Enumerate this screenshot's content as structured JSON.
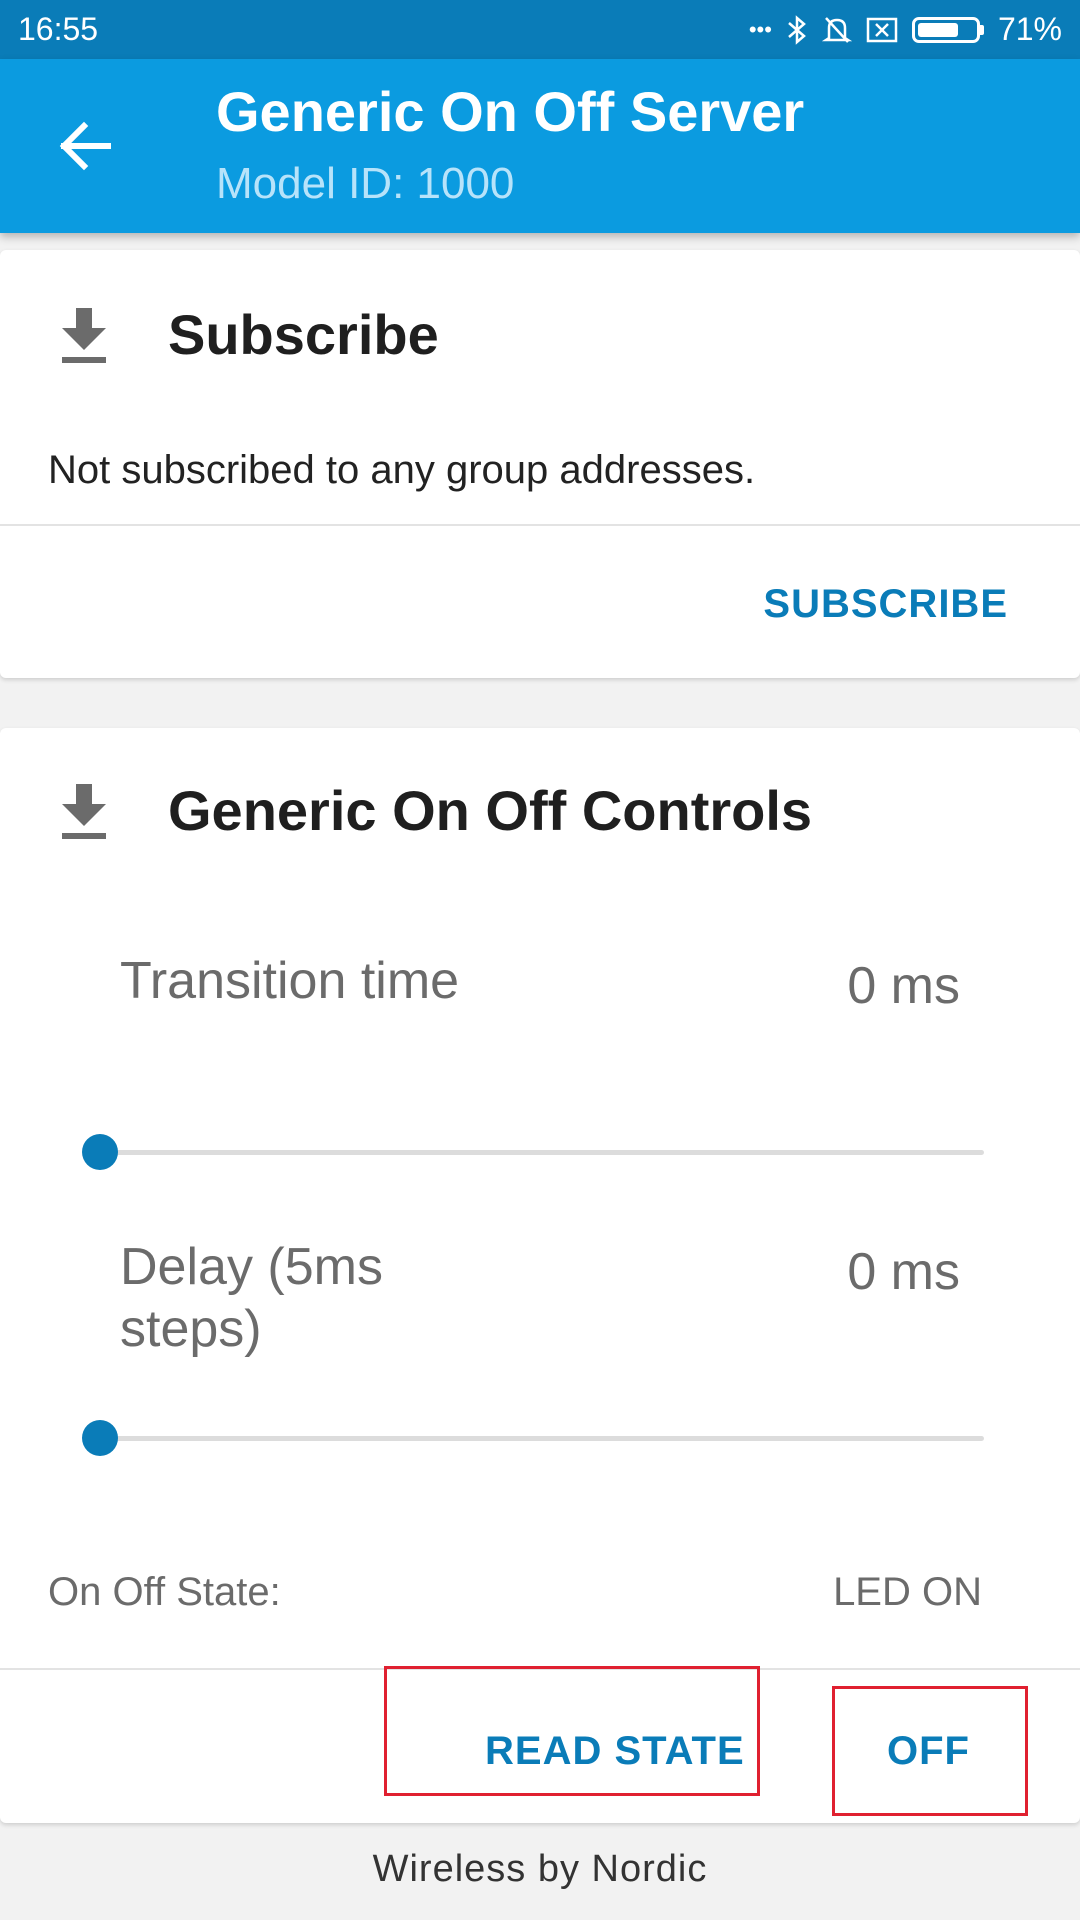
{
  "status_bar": {
    "time": "16:55",
    "dots": "•••",
    "battery_percent": "71%",
    "battery_level": 0.71
  },
  "app_bar": {
    "title": "Generic On Off Server",
    "subtitle": "Model ID: 1000"
  },
  "subscribe_card": {
    "title": "Subscribe",
    "description": "Not subscribed to any group addresses.",
    "subscribe_button": "SUBSCRIBE"
  },
  "controls_card": {
    "title": "Generic On Off Controls",
    "transition": {
      "label": "Transition time",
      "value": "0 ms",
      "fraction": 0
    },
    "delay": {
      "label": "Delay (5ms steps)",
      "value": "0 ms",
      "fraction": 0
    },
    "state_label": "On Off State:",
    "state_value": "LED ON",
    "read_state_button": "READ STATE",
    "off_button": "OFF"
  },
  "footer": "Wireless by Nordic",
  "colors": {
    "primary": "#0b9be0",
    "primary_dark": "#0a7cb8",
    "highlight": "#e02030"
  }
}
